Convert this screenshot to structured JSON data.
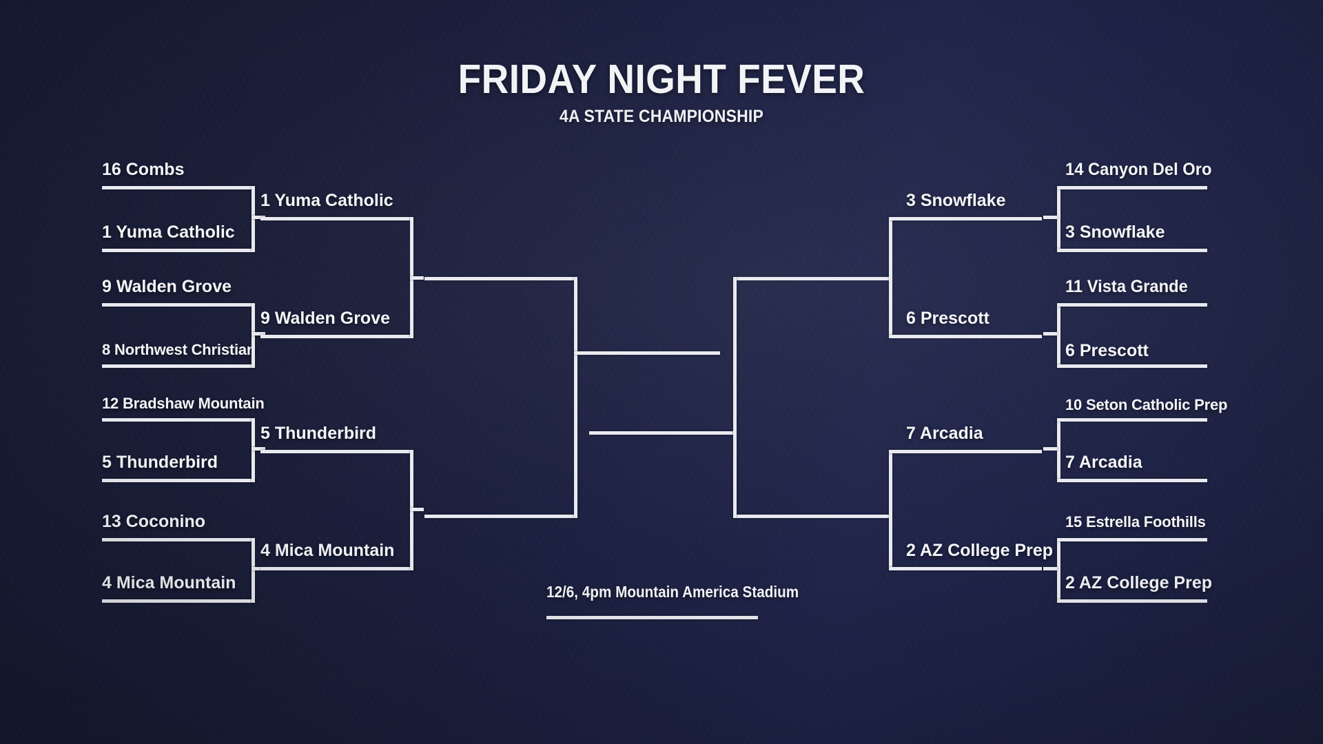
{
  "header": {
    "title": "FRIDAY NIGHT FEVER",
    "subtitle": "4A STATE CHAMPIONSHIP"
  },
  "final": {
    "caption": "12/6, 4pm Mountain America Stadium"
  },
  "bracket": {
    "left": {
      "round1": [
        {
          "seed": "16",
          "team": "Combs",
          "label": "16 Combs"
        },
        {
          "seed": "1",
          "team": "Yuma Catholic",
          "label": "1 Yuma Catholic"
        },
        {
          "seed": "9",
          "team": "Walden Grove",
          "label": "9 Walden Grove"
        },
        {
          "seed": "8",
          "team": "Northwest Christian",
          "label": "8 Northwest Christian"
        },
        {
          "seed": "12",
          "team": "Bradshaw Mountain",
          "label": "12 Bradshaw Mountain"
        },
        {
          "seed": "5",
          "team": "Thunderbird",
          "label": "5 Thunderbird"
        },
        {
          "seed": "13",
          "team": "Coconino",
          "label": "13 Coconino"
        },
        {
          "seed": "4",
          "team": "Mica Mountain",
          "label": "4 Mica Mountain"
        }
      ],
      "round2": [
        {
          "seed": "1",
          "team": "Yuma Catholic",
          "label": "1 Yuma Catholic"
        },
        {
          "seed": "9",
          "team": "Walden Grove",
          "label": "9 Walden Grove"
        },
        {
          "seed": "5",
          "team": "Thunderbird",
          "label": "5 Thunderbird"
        },
        {
          "seed": "4",
          "team": "Mica Mountain",
          "label": "4 Mica Mountain"
        }
      ],
      "round3": [
        {
          "label": ""
        },
        {
          "label": ""
        }
      ]
    },
    "right": {
      "round1": [
        {
          "seed": "14",
          "team": "Canyon Del Oro",
          "label": "14 Canyon Del Oro"
        },
        {
          "seed": "3",
          "team": "Snowflake",
          "label": "3 Snowflake"
        },
        {
          "seed": "11",
          "team": "Vista Grande",
          "label": "11 Vista Grande"
        },
        {
          "seed": "6",
          "team": "Prescott",
          "label": "6 Prescott"
        },
        {
          "seed": "10",
          "team": "Seton Catholic Prep",
          "label": "10 Seton Catholic Prep"
        },
        {
          "seed": "7",
          "team": "Arcadia",
          "label": "7 Arcadia"
        },
        {
          "seed": "15",
          "team": "Estrella Foothills",
          "label": "15 Estrella Foothills"
        },
        {
          "seed": "2",
          "team": "AZ College Prep",
          "label": "2 AZ College Prep"
        }
      ],
      "round2": [
        {
          "seed": "3",
          "team": "Snowflake",
          "label": "3 Snowflake"
        },
        {
          "seed": "6",
          "team": "Prescott",
          "label": "6 Prescott"
        },
        {
          "seed": "7",
          "team": "Arcadia",
          "label": "7 Arcadia"
        },
        {
          "seed": "2",
          "team": "AZ College Prep",
          "label": "2 AZ College Prep"
        }
      ],
      "round3": [
        {
          "label": ""
        },
        {
          "label": ""
        }
      ]
    }
  },
  "colors": {
    "background_dark": "#171b33",
    "background_light": "#1f2449",
    "bracket_line": "#e8eaf0",
    "text": "#f4f5f9"
  }
}
